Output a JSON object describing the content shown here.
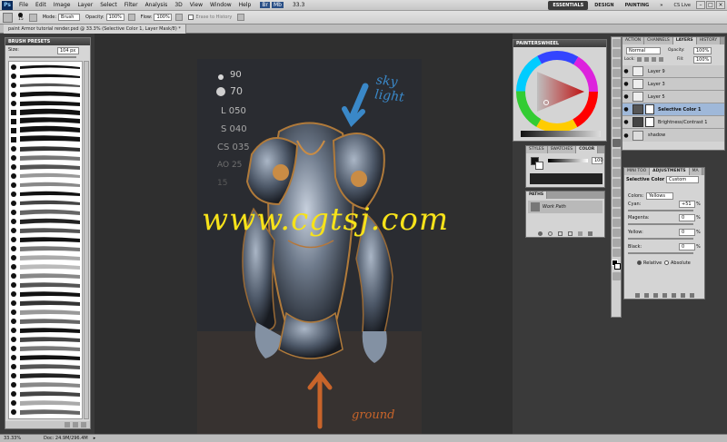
{
  "menu": {
    "logo": "Ps",
    "items": [
      "File",
      "Edit",
      "Image",
      "Layer",
      "Select",
      "Filter",
      "Analysis",
      "3D",
      "View",
      "Window",
      "Help"
    ],
    "zoom": "33.3",
    "workspaces": [
      "ESSENTIALS",
      "DESIGN",
      "PAINTING"
    ],
    "active_workspace": "ESSENTIALS",
    "cs_live": "CS Live"
  },
  "options": {
    "brush_size": "15",
    "mode_label": "Mode:",
    "mode_value": "Brush",
    "opacity_label": "Opacity:",
    "opacity_value": "100%",
    "flow_label": "Flow:",
    "flow_value": "100%",
    "erase_to_history": "Erase to History"
  },
  "document": {
    "tab_title": "paint Armor tutorial render.psd @ 33.3% (Selective Color 1, Layer Mask/8) *",
    "zoom_status": "33.33%",
    "doc_status": "Doc: 24.9M/296.4M"
  },
  "artwork": {
    "watermark": "www.cgtsj.com",
    "sky_label": "sky light",
    "ground_label": "ground",
    "notes": [
      "90",
      "70",
      "L 050",
      "S 040",
      "CS 035",
      "AO 25",
      "15"
    ]
  },
  "brush_presets": {
    "title": "BRUSH PRESETS",
    "size_label": "Size:",
    "size_value": "104 px"
  },
  "painter_wheel": {
    "title": "PAINTERSWHEEL"
  },
  "color_panel": {
    "tabs": [
      "STYLES",
      "SWATCHES",
      "COLOR"
    ],
    "active_tab": "COLOR",
    "value": "100"
  },
  "paths_panel": {
    "title": "PATHS",
    "item": "Work Path"
  },
  "layers_panel": {
    "tabs": [
      "ACTION",
      "CHANNELS",
      "LAYERS",
      "HISTORY"
    ],
    "active_tab": "LAYERS",
    "blend_mode": "Normal",
    "opacity_label": "Opacity:",
    "opacity_value": "100%",
    "lock_label": "Lock:",
    "fill_label": "Fill:",
    "fill_value": "100%",
    "layers": [
      {
        "name": "Layer 9",
        "selected": false
      },
      {
        "name": "Layer 3",
        "selected": false
      },
      {
        "name": "Layer 5",
        "selected": false
      },
      {
        "name": "Selective Color 1",
        "selected": true
      },
      {
        "name": "Brightness/Contrast 1",
        "selected": false
      },
      {
        "name": "shadow",
        "selected": false
      }
    ]
  },
  "adjustments_panel": {
    "tabs": [
      "MINI TOO",
      "ADJUSTMENTS",
      "MA"
    ],
    "active_tab": "ADJUSTMENTS",
    "title": "Selective Color",
    "preset": "Custom",
    "colors_label": "Colors:",
    "colors_value": "Yellows",
    "sliders": [
      {
        "label": "Cyan:",
        "value": "+51",
        "unit": "%"
      },
      {
        "label": "Magenta:",
        "value": "0",
        "unit": "%"
      },
      {
        "label": "Yellow:",
        "value": "0",
        "unit": "%"
      },
      {
        "label": "Black:",
        "value": "0",
        "unit": "%"
      }
    ],
    "relative": "Relative",
    "absolute": "Absolute"
  },
  "colors": {
    "accent": "#3b7bd8",
    "watermark": "#f6e21a",
    "sky_blue": "#3a88c8",
    "ground_orange": "#c8642a"
  }
}
